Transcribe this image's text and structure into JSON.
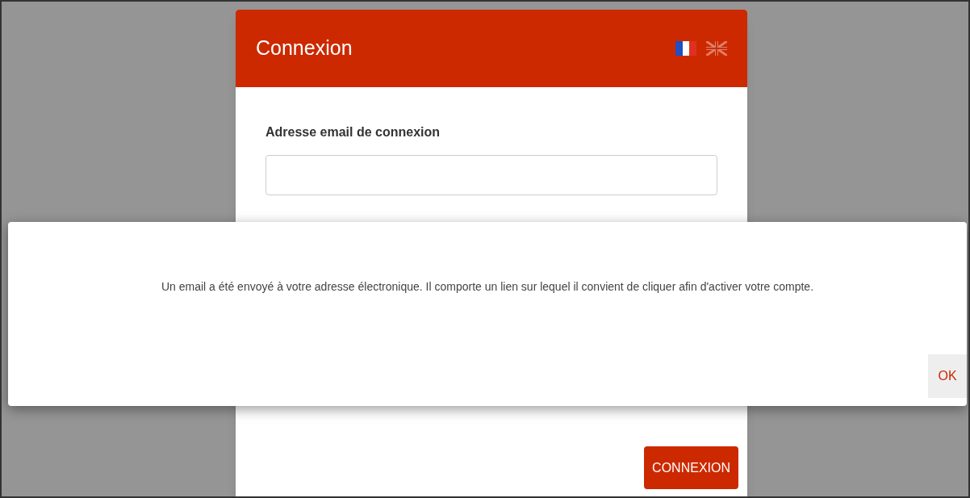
{
  "card": {
    "title": "Connexion",
    "languages": [
      {
        "kind": "french",
        "selected": true
      },
      {
        "kind": "english",
        "selected": false
      }
    ],
    "email_label": "Adresse email de connexion",
    "submit": "CONNEXION"
  },
  "dialog": {
    "message": "Un email a été envoyé à votre adresse électronique. Il comporte un lien sur lequel il convient de cliquer afin d'activer votre compte.",
    "ok": "OK"
  }
}
